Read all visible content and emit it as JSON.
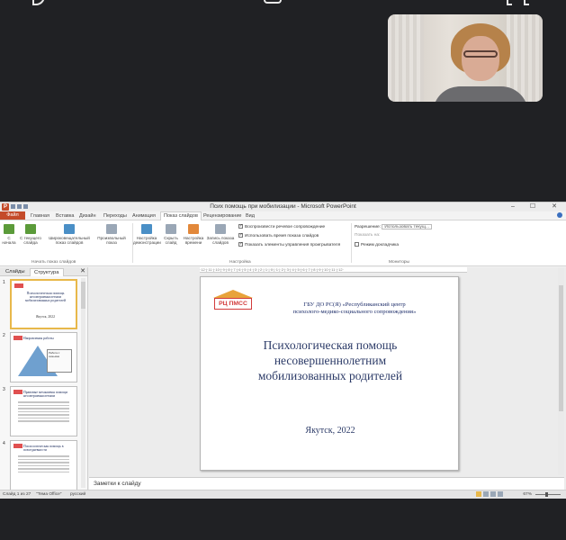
{
  "window": {
    "title": "Псих помощь при мобилизации  -  Microsoft PowerPoint",
    "min": "–",
    "max": "☐",
    "close": "✕"
  },
  "tabs": [
    "Файл",
    "Главная",
    "Вставка",
    "Дизайн",
    "Переходы",
    "Анимация",
    "Показ слайдов",
    "Рецензирование",
    "Вид"
  ],
  "ribbon": {
    "buttons": [
      "С начала",
      "С текущего слайда",
      "Широковещательный показ слайдов",
      "Произвольный показ",
      "Настройка демонстрации",
      "Скрыть слайд",
      "Настройка времени",
      "Запись показа слайдов"
    ],
    "group1": "Начать показ слайдов",
    "group2": "Настройка",
    "group3": "Мониторы",
    "checkboxes": [
      "Воспроизвести речевое сопровождение",
      "Использовать время показа слайдов",
      "Показать элементы управления проигрывателя"
    ],
    "resolution_label": "Разрешение:",
    "resolution_value": "Использовать текущ...",
    "show_on_label": "Показать на:",
    "presenter_view": "Режим докладчика"
  },
  "pane": {
    "tab_slides": "Слайды",
    "tab_outline": "Структура",
    "close": "✕",
    "thumbs": [
      {
        "num": "1",
        "title": "Психологическая помощь несовершеннолетним мобилизованных родителей",
        "sub": "Якутск, 2022"
      },
      {
        "num": "2",
        "title": "Направления работы",
        "box": "Работа с семьями"
      },
      {
        "num": "3",
        "title": "Правовые механизмы помощи несовершеннолетним"
      },
      {
        "num": "4",
        "title": "Психологическая помощь в повседневности"
      }
    ]
  },
  "ruler": "·12·|·11·|·10·|·9·|·8·|·7·|·6·|·5·|·4·|·3·|·2·|·1·|·0·|·1·|·2·|·3·|·4·|·5·|·6·|·7·|·8·|·9·|·10·|·11·|·12·",
  "slide": {
    "logo": "РЦ ПМСС",
    "org_line1": "ГБУ ДО РС(Я) «Республиканский центр",
    "org_line2": "психолого-медико-социального сопровождения»",
    "title_l1": "Психологическая помощь",
    "title_l2": "несовершеннолетним",
    "title_l3": "мобилизованных родителей",
    "date": "Якутск, 2022"
  },
  "notes_placeholder": "Заметки к слайду",
  "status": {
    "slide": "Слайд 1 из 27",
    "theme": "\"Тема Office\"",
    "lang": "русский",
    "zoom": "67%"
  }
}
